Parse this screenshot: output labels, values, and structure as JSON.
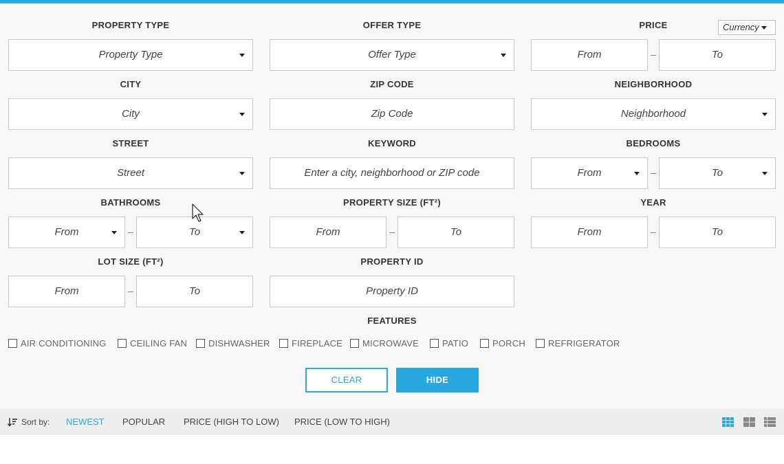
{
  "colors": {
    "accent": "#29a8e0",
    "panel": "#f7f7f7",
    "sortbar": "#eeeeee"
  },
  "labels": {
    "property_type": "PROPERTY TYPE",
    "offer_type": "OFFER TYPE",
    "price": "PRICE",
    "city": "CITY",
    "zip_code": "ZIP CODE",
    "neighborhood": "NEIGHBORHOOD",
    "street": "STREET",
    "keyword": "KEYWORD",
    "bedrooms": "BEDROOMS",
    "bathrooms": "BATHROOMS",
    "property_size": "PROPERTY SIZE (FT²)",
    "year": "YEAR",
    "lot_size": "LOT SIZE (FT²)",
    "property_id": "PROPERTY ID",
    "features": "FEATURES"
  },
  "fields": {
    "property_type": "Property Type",
    "offer_type": "Offer Type",
    "price_from": "From",
    "price_to": "To",
    "currency": "Currency",
    "city": "City",
    "zip_code": "Zip Code",
    "neighborhood": "Neighborhood",
    "street": "Street",
    "keyword": "Enter a city, neighborhood or ZIP code",
    "bedrooms_from": "From",
    "bedrooms_to": "To",
    "bathrooms_from": "From",
    "bathrooms_to": "To",
    "size_from": "From",
    "size_to": "To",
    "year_from": "From",
    "year_to": "To",
    "lot_from": "From",
    "lot_to": "To",
    "property_id": "Property ID"
  },
  "features": [
    "AIR CONDITIONING",
    "CEILING FAN",
    "DISHWASHER",
    "FIREPLACE",
    "MICROWAVE",
    "PATIO",
    "PORCH",
    "REFRIGERATOR"
  ],
  "buttons": {
    "clear": "CLEAR",
    "hide": "HIDE"
  },
  "sort": {
    "label": "Sort by:",
    "options": [
      "NEWEST",
      "POPULAR",
      "PRICE (HIGH TO LOW)",
      "PRICE (LOW TO HIGH)"
    ],
    "active": "NEWEST"
  },
  "views": [
    "grid-small-icon",
    "grid-large-icon",
    "list-icon"
  ]
}
